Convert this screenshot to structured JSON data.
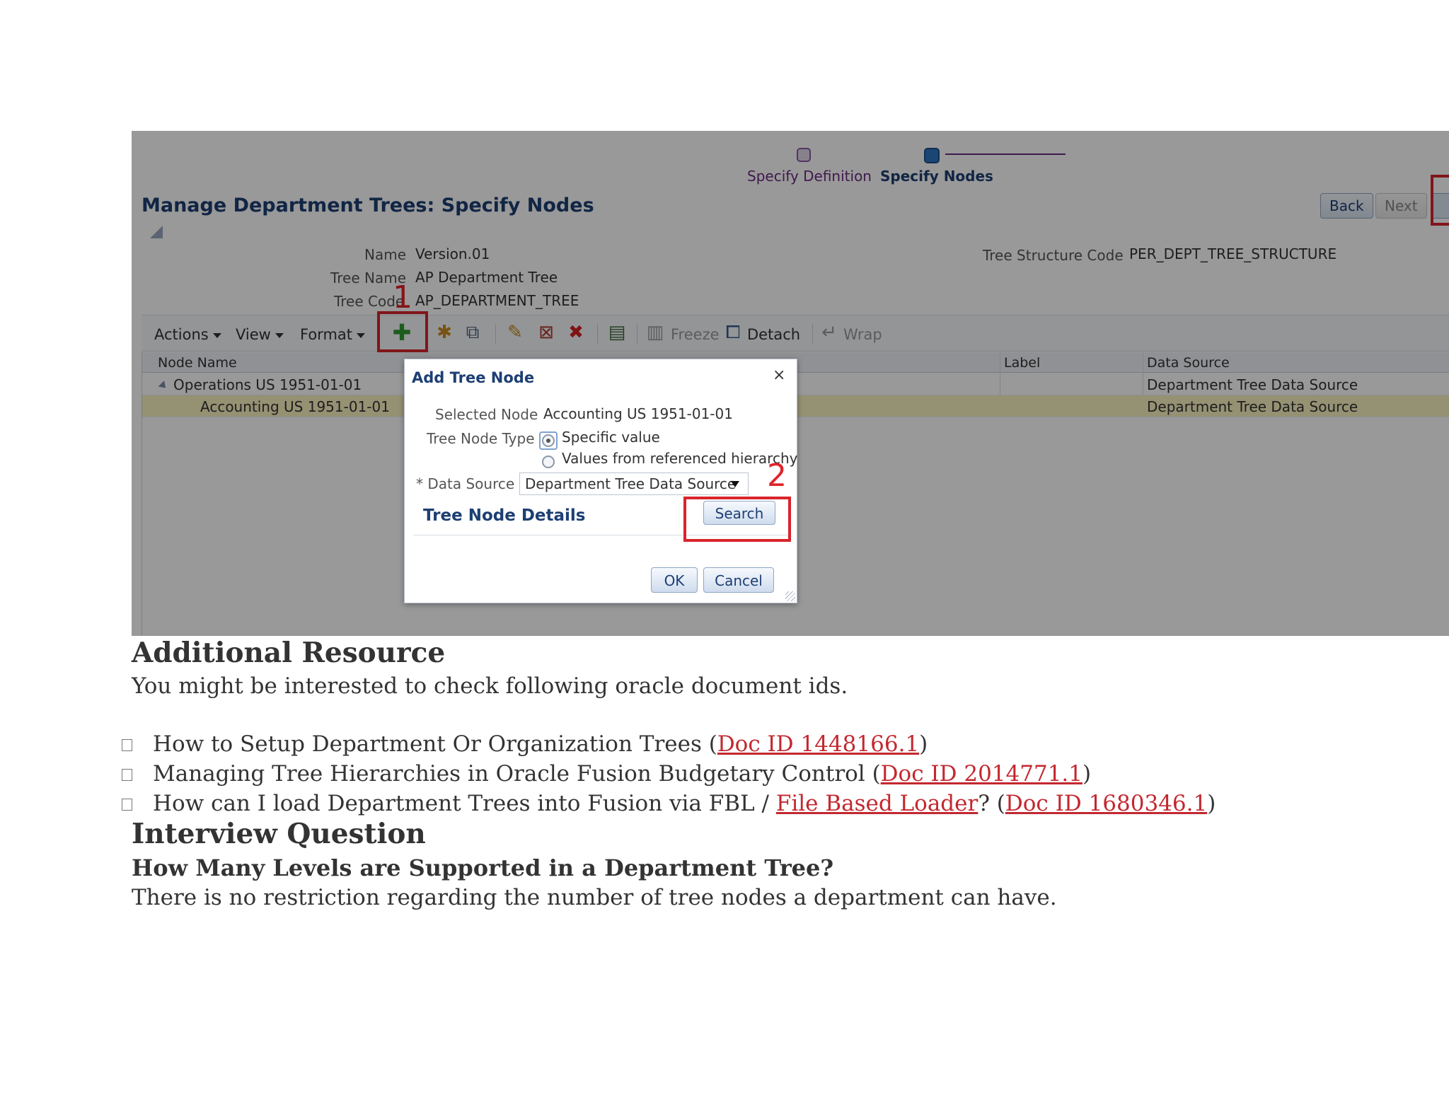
{
  "screenshot": {
    "train": {
      "step1": "Specify Definition",
      "step2": "Specify Nodes"
    },
    "page_title": "Manage Department Trees: Specify Nodes",
    "buttons": {
      "back": "Back",
      "next": "Next"
    },
    "fields": {
      "name_label": "Name",
      "name_value": "Version.01",
      "tree_name_label": "Tree Name",
      "tree_name_value": "AP Department Tree",
      "tree_code_label": "Tree Code",
      "tree_code_value": "AP_DEPARTMENT_TREE",
      "tree_structure_code_label": "Tree Structure Code",
      "tree_structure_code_value": "PER_DEPT_TREE_STRUCTURE"
    },
    "annotations": {
      "mark1": "1",
      "mark2": "2"
    },
    "toolbar": {
      "actions": "Actions",
      "view": "View",
      "format": "Format",
      "freeze": "Freeze",
      "detach": "Detach",
      "wrap": "Wrap"
    },
    "table": {
      "headers": {
        "node_name": "Node Name",
        "label": "Label",
        "data_source": "Data Source"
      },
      "rows": [
        {
          "node_name": "Operations US 1951-01-01",
          "label": "",
          "data_source": "Department Tree Data Source"
        },
        {
          "node_name": "Accounting US 1951-01-01",
          "label": "",
          "data_source": "Department Tree Data Source"
        }
      ]
    },
    "dialog": {
      "title": "Add Tree Node",
      "close": "×",
      "selected_node_label": "Selected Node",
      "selected_node_value": "Accounting US 1951-01-01",
      "tree_node_type_label": "Tree Node Type",
      "option_specific": "Specific value",
      "option_referenced": "Values from referenced hierarchy",
      "data_source_label": "* Data Source",
      "data_source_value": "Department Tree Data Source",
      "section_title": "Tree Node Details",
      "search": "Search",
      "ok": "OK",
      "cancel": "Cancel"
    }
  },
  "document": {
    "heading1": "Additional Resource",
    "intro": "You might be interested to check following oracle document ids.",
    "bullets": [
      {
        "prefix": "How to Setup Department Or Organization Trees (",
        "link": "Doc ID 1448166.1",
        "suffix": ")"
      },
      {
        "prefix": "Managing Tree Hierarchies in Oracle Fusion Budgetary Control (",
        "link": "Doc ID 2014771.1",
        "suffix": ")"
      },
      {
        "prefix": "How can I load Department Trees into Fusion via FBL / ",
        "link": "File Based Loader",
        "middle": "? (",
        "link2": "Doc ID 1680346.1",
        "suffix": ")"
      }
    ],
    "heading2": "Interview Question",
    "question": "How Many Levels are Supported in a Department Tree?",
    "answer": "There is no restriction regarding the number of tree nodes a department can have."
  },
  "colors": {
    "link": "#c3282f",
    "annotation_red": "#d9242c",
    "title_blue": "#1d3f73"
  }
}
